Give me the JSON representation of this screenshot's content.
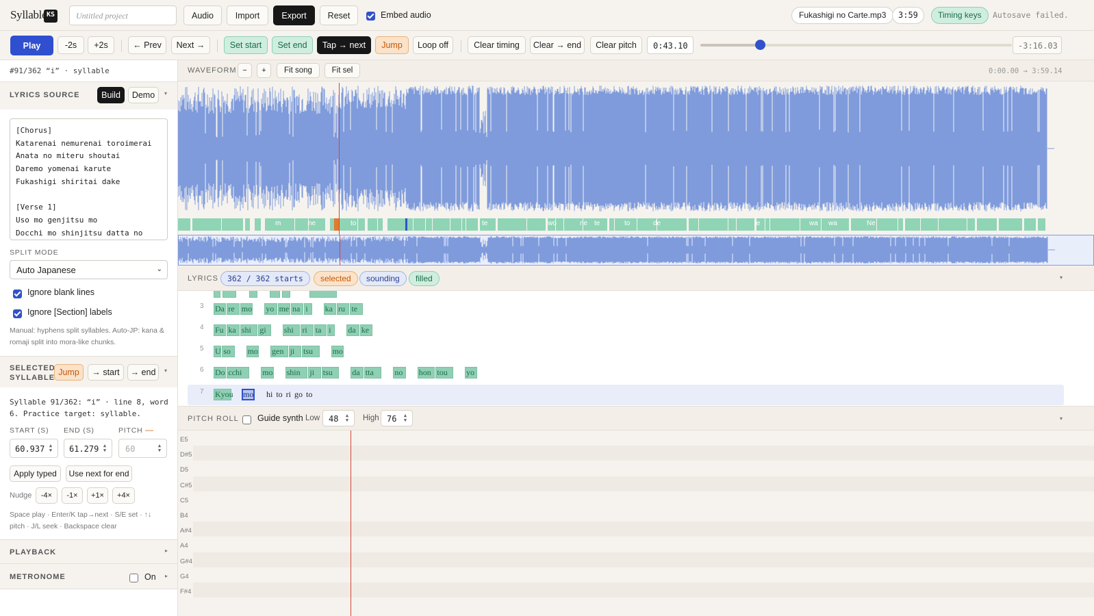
{
  "app": {
    "logo": "Syllable",
    "badge": "KS"
  },
  "topbar": {
    "project_placeholder": "Untitled project",
    "audio": "Audio",
    "import": "Import",
    "export": "Export",
    "reset": "Reset",
    "embed_audio": "Embed audio",
    "filename": "Fukashigi no Carte.mp3",
    "duration": "3:59",
    "timing_keys": "Timing keys",
    "autosave": "Autosave failed."
  },
  "toolbar": {
    "play": "Play",
    "back2": "-2s",
    "fwd2": "+2s",
    "prev": "← Prev",
    "next": "Next →",
    "set_start": "Set start",
    "set_end": "Set end",
    "tap_next": "Tap → next",
    "jump": "Jump",
    "loop": "Loop off",
    "clear_timing": "Clear timing",
    "clear_to_end": "Clear → end",
    "clear_pitch": "Clear pitch",
    "time": "0:43.10",
    "position_fraction": 0.192,
    "remaining": "-3:16.03"
  },
  "sidebar": {
    "selection_info": "#91/362 “i” · syllable",
    "lyrics_source": "LYRICS SOURCE",
    "build": "Build",
    "demo": "Demo",
    "lyrics_text": "[Chorus]\nKatarenai nemurenai toroimerai\nAnata no miteru shoutai\nDaremo yomenai karute\nFukashigi shiritai dake\n\n[Verse 1]\nUso mo genjitsu mo\nDocchi mo shinjitsu datta no",
    "split_mode_label": "SPLIT MODE",
    "split_mode": "Auto Japanese",
    "ignore_blank": "Ignore blank lines",
    "ignore_section": "Ignore [Section] labels",
    "split_hint": "Manual: hyphens split syllables. Auto-JP: kana & romaji split into mora-like chunks.",
    "selected_syllable": "SELECTED SYLLABLE",
    "jump": "Jump",
    "to_start": "→ start",
    "to_end": "→ end",
    "syllable_desc": "Syllable 91/362: “i” · line 8, word 6. Practice target: syllable.",
    "start_label": "START (S)",
    "end_label": "END (S)",
    "pitch_label": "PITCH",
    "pitch_dash": "—",
    "start_value": "60.937",
    "end_value": "61.279",
    "pitch_placeholder": "60",
    "apply_typed": "Apply typed",
    "use_next": "Use next for end",
    "nudge": "Nudge",
    "n4m": "-4×",
    "n1m": "-1×",
    "n1p": "+1×",
    "n4p": "+4×",
    "shortcuts": "Space play · Enter/K tap→next · S/E set · ↑↓ pitch · J/L seek · Backspace clear",
    "playback": "PLAYBACK",
    "metronome": "METRONOME",
    "metronome_on": "On"
  },
  "waveform": {
    "title": "WAVEFORM",
    "minus": "−",
    "plus": "+",
    "fit_song": "Fit song",
    "fit_sel": "Fit sel",
    "range": "0:00.00 → 3:59.14",
    "segment_labels": [
      "m",
      "ne",
      "to",
      "te",
      "wo",
      "ne",
      "te",
      "to",
      "de",
      "te",
      "wa",
      "wa",
      "Ne"
    ]
  },
  "lyrics": {
    "title": "LYRICS",
    "count": "362 / 362 starts",
    "selected": "selected",
    "sounding": "sounding",
    "filled": "filled",
    "lines": [
      {
        "num": "3",
        "words": [
          [
            "Da",
            "re",
            "mo"
          ],
          [
            "yo",
            "me",
            "na",
            "i"
          ],
          [
            "ka",
            "ru",
            "te"
          ]
        ]
      },
      {
        "num": "4",
        "words": [
          [
            "Fu",
            "ka",
            "shi",
            "gi"
          ],
          [
            "shi",
            "ri",
            "ta",
            "i"
          ],
          [
            "da",
            "ke"
          ]
        ]
      },
      {
        "num": "5",
        "words": [
          [
            "U",
            "so"
          ],
          [
            "mo"
          ],
          [
            "gen",
            "ji",
            "tsu"
          ],
          [
            "mo"
          ]
        ]
      },
      {
        "num": "6",
        "words": [
          [
            "Do",
            "cchi"
          ],
          [
            "mo"
          ],
          [
            "shin",
            "ji",
            "tsu"
          ],
          [
            "da",
            "tta"
          ],
          [
            "no"
          ],
          [
            "hon",
            "tou"
          ],
          [
            "yo"
          ]
        ]
      }
    ],
    "line7": {
      "num": "7",
      "kyou": "Kyou",
      "mo": "mo",
      "rest": "hi to ri go to"
    }
  },
  "pitch": {
    "title": "PITCH ROLL",
    "guide": "Guide synth",
    "low_label": "Low",
    "low": "48",
    "high_label": "High",
    "high": "76",
    "notes": [
      "E5",
      "D#5",
      "D5",
      "C#5",
      "C5",
      "B4",
      "A#4",
      "A4",
      "G#4",
      "G4",
      "F#4"
    ]
  },
  "colors": {
    "accent": "#3152c8",
    "wave": "#7f9bdc",
    "segment": "#8fd4b5",
    "playhead": "#d0453a"
  }
}
